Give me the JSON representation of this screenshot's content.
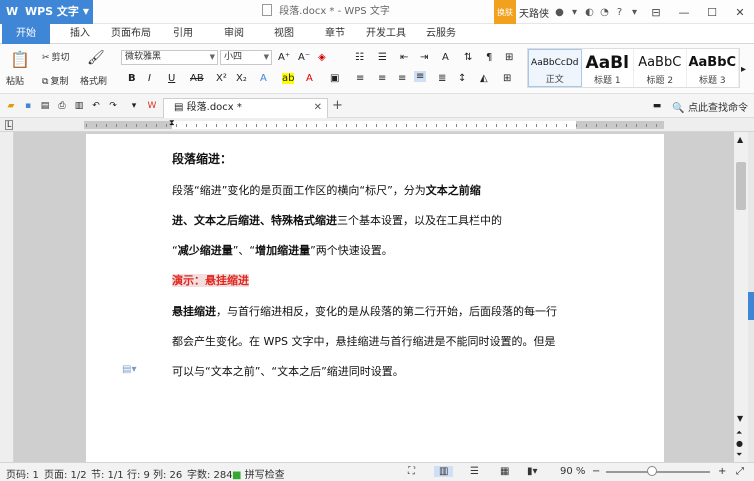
{
  "titlebar": {
    "app_name": "WPS 文字",
    "doc_title": "段落.docx * - WPS 文字",
    "skin_label": "换肤",
    "username": "天路侠"
  },
  "menu": [
    "开始",
    "插入",
    "页面布局",
    "引用",
    "审阅",
    "视图",
    "章节",
    "开发工具",
    "云服务"
  ],
  "ribbon": {
    "cut": "剪切",
    "copy": "复制",
    "paste": "粘贴",
    "format_painter": "格式刷",
    "font_name": "微软雅黑",
    "font_size": "小四",
    "styles": [
      {
        "sample": "AaBbCcDd",
        "name": "正文"
      },
      {
        "sample": "AaBl",
        "name": "标题 1"
      },
      {
        "sample": "AaBbC",
        "name": "标题 2"
      },
      {
        "sample": "AaBbC",
        "name": "标题 3"
      }
    ]
  },
  "tab": {
    "doc_name": "段落.docx *",
    "find_command": "点此查找命令"
  },
  "document": {
    "heading": "段落缩进：",
    "p1_line1_a": "段落“缩进”变化的是页面工作区的横向“标尺”，分为",
    "p1_line1_b": "文本之前缩",
    "p1_line2_a": "进、文本之后缩进、特殊格式缩进",
    "p1_line2_b": "三个基本设置，以及在工具栏中的",
    "p1_line3_a": "“",
    "p1_line3_b": "减少缩进量",
    "p1_line3_c": "”、“",
    "p1_line3_d": "增加缩进量",
    "p1_line3_e": "”两个快速设置。",
    "demo": "演示：悬挂缩进",
    "p2_line1_a": "悬挂缩进",
    "p2_line1_b": "，与首行缩进相反，变化的是从段落的第二行开始，后面段落的每一行",
    "p2_line2": "都会产生变化。在 WPS 文字中，悬挂缩进与首行缩进是不能同时设置的。但是",
    "p2_line3": "可以与“文本之前”、“文本之后”缩进同时设置。"
  },
  "status": {
    "row_num": "页码: 1",
    "page": "页面: 1/2",
    "section": "节: 1/1",
    "line": "行: 9",
    "col": "列: 26",
    "words": "字数: 284",
    "spell": "拼写检查",
    "zoom": "90 %"
  }
}
